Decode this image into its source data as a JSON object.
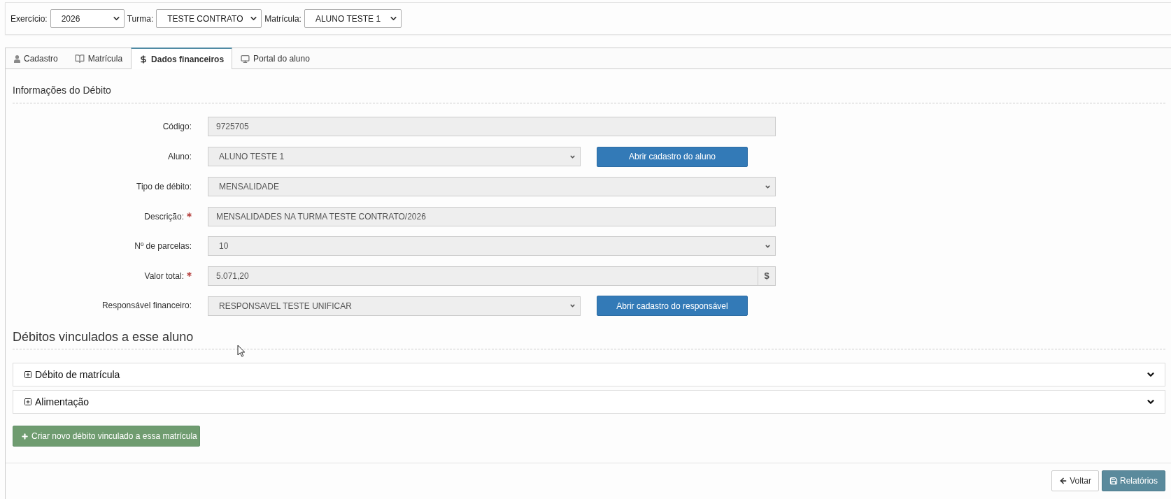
{
  "filters": [
    {
      "label": "Exercício:",
      "value": "2026"
    },
    {
      "label": "Turma:",
      "value": "TESTE CONTRATO"
    },
    {
      "label": "Matrícula:",
      "value": "ALUNO TESTE 1"
    }
  ],
  "tabs": [
    {
      "label": "Cadastro",
      "selected": false
    },
    {
      "label": "Matrícula",
      "selected": false
    },
    {
      "label": "Dados financeiros",
      "selected": true
    },
    {
      "label": "Portal do aluno",
      "selected": false
    }
  ],
  "section": {
    "title": "Informações do Débito",
    "fields": [
      {
        "label": "Código:",
        "kind": "text",
        "value": "9725705",
        "required": false,
        "disabled": true
      },
      {
        "label": "Aluno:",
        "kind": "select",
        "value": "ALUNO TESTE 1",
        "required": false,
        "disabled": true,
        "button": "Abrir cadastro do aluno"
      },
      {
        "label": "Tipo de débito:",
        "kind": "select",
        "value": "MENSALIDADE",
        "required": false,
        "disabled": true
      },
      {
        "label": "Descrição:",
        "kind": "text",
        "value": "MENSALIDADES NA TURMA TESTE CONTRATO/2026",
        "required": true,
        "disabled": true
      },
      {
        "label": "Nº de parcelas:",
        "kind": "select",
        "value": "10",
        "required": false,
        "disabled": true
      },
      {
        "label": "Valor total:",
        "kind": "money",
        "value": "5.071,20",
        "addon": "$",
        "required": true,
        "disabled": true
      },
      {
        "label": "Responsável financeiro:",
        "kind": "select",
        "value": "RESPONSAVEL TESTE UNIFICAR",
        "required": false,
        "disabled": true,
        "button": "Abrir cadastro do responsável"
      }
    ]
  },
  "linked": {
    "title": "Débitos vinculados a esse aluno",
    "items": [
      {
        "title": "Débito de matrícula",
        "expanded": false
      },
      {
        "title": "Alimentação",
        "expanded": false
      }
    ],
    "create_button": "Criar novo débito vinculado a essa matrícula"
  },
  "footer": {
    "buttons": [
      {
        "label": "Voltar",
        "kind": "back"
      },
      {
        "label": "Relatórios",
        "kind": "save"
      }
    ]
  }
}
